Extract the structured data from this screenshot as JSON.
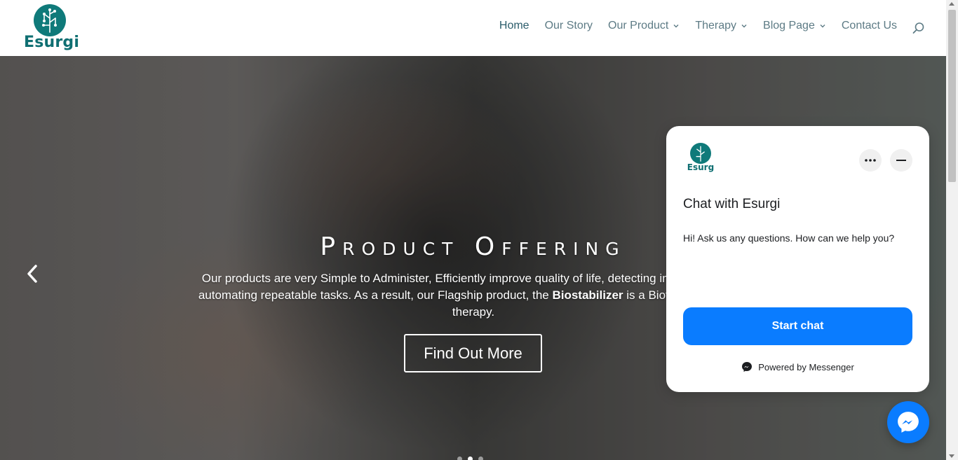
{
  "header": {
    "logo_text": "Esurgi",
    "nav": [
      {
        "label": "Home",
        "dropdown": false,
        "active": true
      },
      {
        "label": "Our Story",
        "dropdown": false,
        "active": false
      },
      {
        "label": "Our Product",
        "dropdown": true,
        "active": false
      },
      {
        "label": "Therapy",
        "dropdown": true,
        "active": false
      },
      {
        "label": "Blog Page",
        "dropdown": true,
        "active": false
      },
      {
        "label": "Contact Us",
        "dropdown": false,
        "active": false
      }
    ],
    "search_icon": "search-icon"
  },
  "hero": {
    "title": "Product Offering",
    "text_part1": "Our products are very Simple to Administer, Efficiently improve quality of life, detecting individual biome",
    "text_part2": "automating repeatable tasks. As a result, our Flagship product, the ",
    "text_bold": "Biostabilizer",
    "text_part3": " is a Biofeedback Unit p",
    "text_part4": "therapy.",
    "button_label": "Find Out More",
    "prev_icon": "chevron-left-icon",
    "slides": 3,
    "active_slide": 2
  },
  "chat_widget": {
    "logo_text": "Esurg",
    "title": "Chat with Esurgi",
    "message": "Hi! Ask us any questions. How can we help you?",
    "start_label": "Start chat",
    "powered_by": "Powered by Messenger",
    "more_icon": "more-icon",
    "minimize_icon": "minimize-icon"
  },
  "colors": {
    "brand_teal": "#0f7a7a",
    "nav_text": "#5d7b85",
    "messenger_blue": "#0a7cff"
  }
}
